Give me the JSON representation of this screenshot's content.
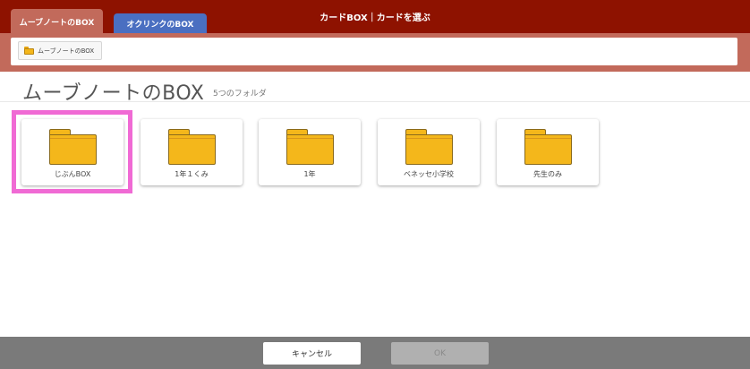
{
  "tabs": [
    {
      "label": "ムーブノートのBOX",
      "active": true
    },
    {
      "label": "オクリンクのBOX",
      "active": false
    }
  ],
  "window_title": "カードBOX｜カードを選ぶ",
  "breadcrumb": {
    "label": "ムーブノートのBOX",
    "icon": "folder-icon"
  },
  "header": {
    "title": "ムーブノートのBOX",
    "count_text": "5つのフォルダ"
  },
  "folders": [
    {
      "label": "じぶんBOX",
      "selected": true
    },
    {
      "label": "1年１くみ",
      "selected": false
    },
    {
      "label": "1年",
      "selected": false
    },
    {
      "label": "ベネッセ小学校",
      "selected": false
    },
    {
      "label": "先生のみ",
      "selected": false
    }
  ],
  "footer": {
    "cancel_label": "キャンセル",
    "ok_label": "OK"
  },
  "colors": {
    "topbar": "#8e1200",
    "active_tab": "#c26a5b",
    "inactive_tab": "#4a6fc1",
    "folder": "#f4b71b",
    "selection": "#f06ad4",
    "footer": "#7a7a7a"
  }
}
